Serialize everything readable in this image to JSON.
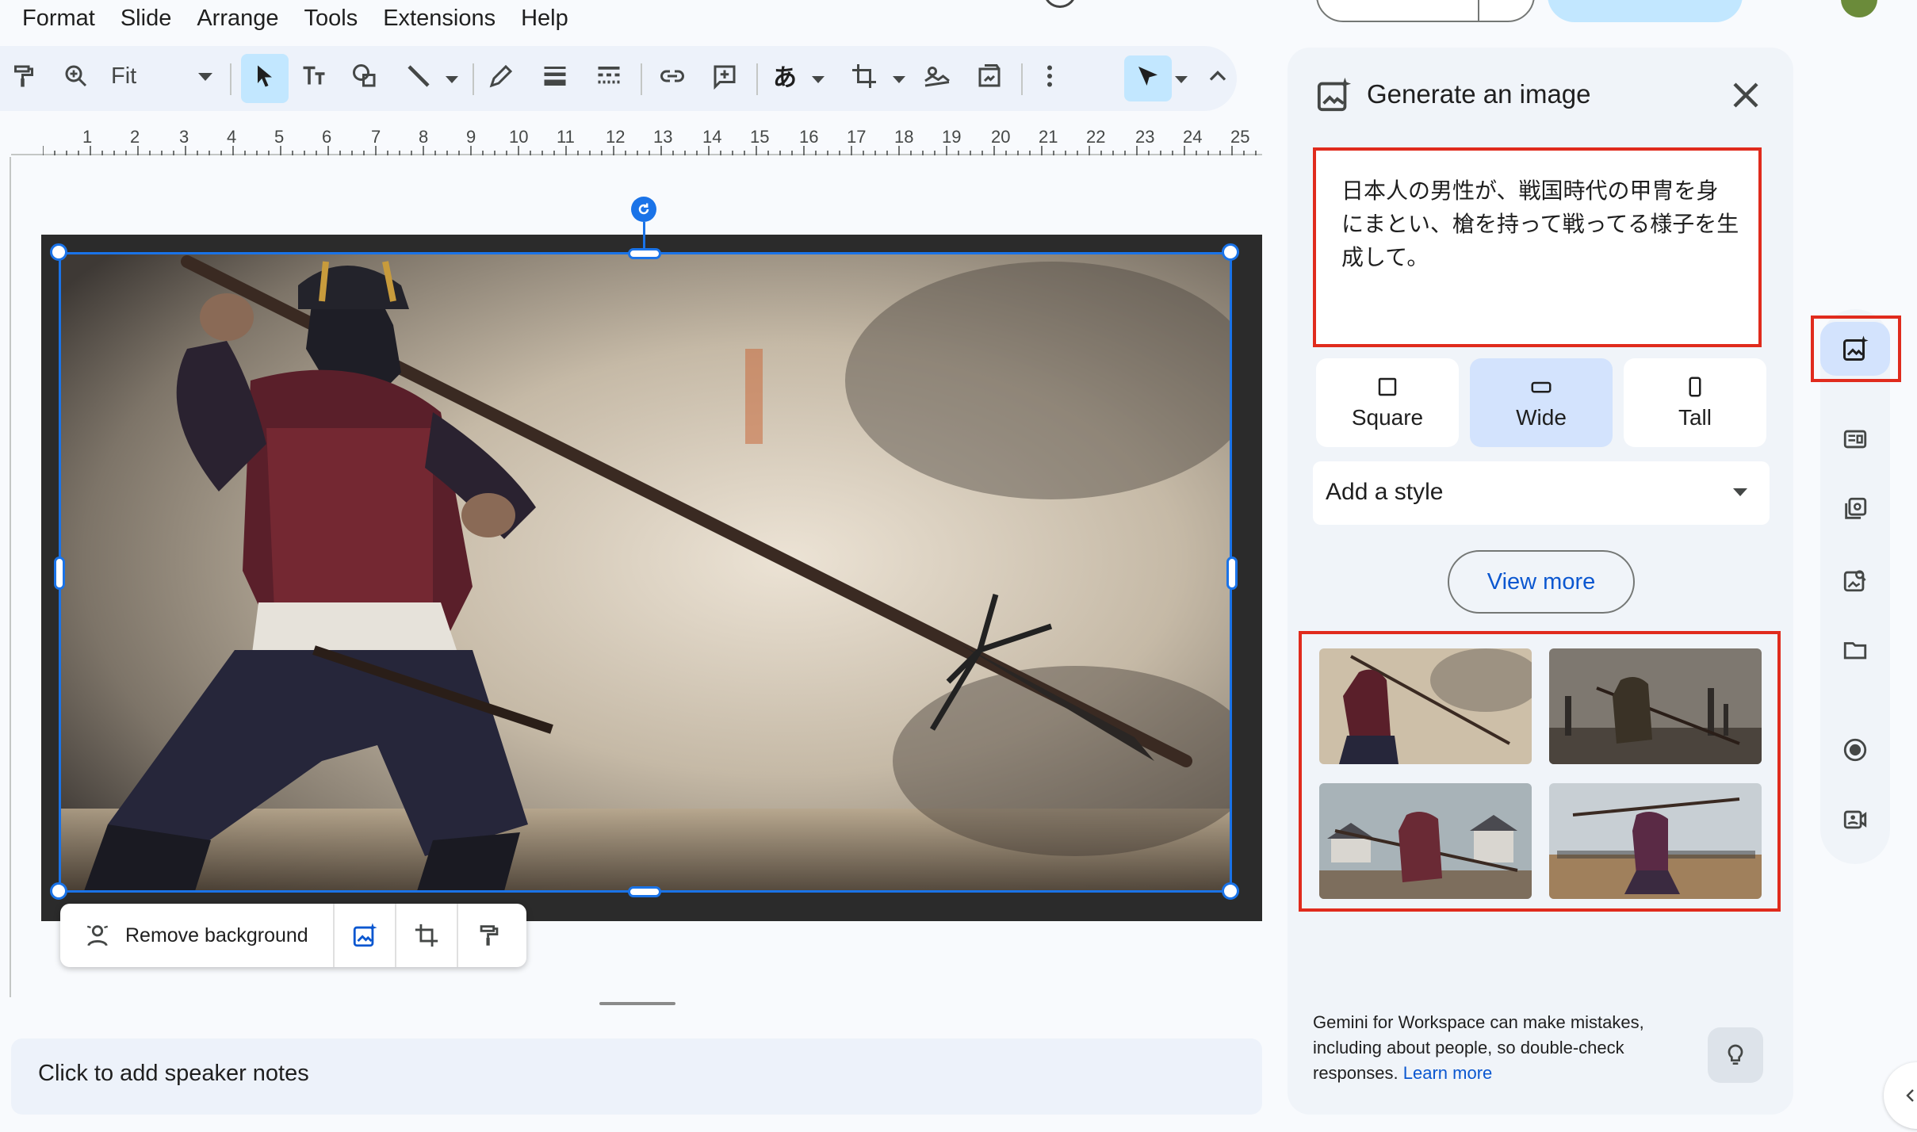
{
  "menu": {
    "items": [
      "Format",
      "Slide",
      "Arrange",
      "Tools",
      "Extensions",
      "Help"
    ]
  },
  "toolbar": {
    "zoom_value": "Fit"
  },
  "ruler": {
    "labels": [
      "1",
      "2",
      "3",
      "4",
      "5",
      "6",
      "7",
      "8",
      "9",
      "10",
      "11",
      "12",
      "13",
      "14",
      "15",
      "16",
      "17",
      "18",
      "19",
      "20",
      "21",
      "22",
      "23",
      "24",
      "25"
    ]
  },
  "image_toolbar": {
    "remove_background_label": "Remove background"
  },
  "notes": {
    "placeholder": "Click to add speaker notes"
  },
  "panel": {
    "title": "Generate an image",
    "prompt": "日本人の男性が、戦国時代の甲冑を身にまとい、槍を持って戦ってる様子を生成して。",
    "aspect_options": [
      {
        "label": "Square",
        "selected": false
      },
      {
        "label": "Wide",
        "selected": true
      },
      {
        "label": "Tall",
        "selected": false
      }
    ],
    "style_placeholder": "Add a style",
    "view_more_label": "View more",
    "disclaimer": "Gemini for Workspace can make mistakes, including about people, so double-check responses.",
    "learn_more": "Learn more"
  },
  "colors": {
    "accent": "#1a73e8",
    "highlight_border": "#e02b1d",
    "selected_chip": "#d3e3fd"
  }
}
